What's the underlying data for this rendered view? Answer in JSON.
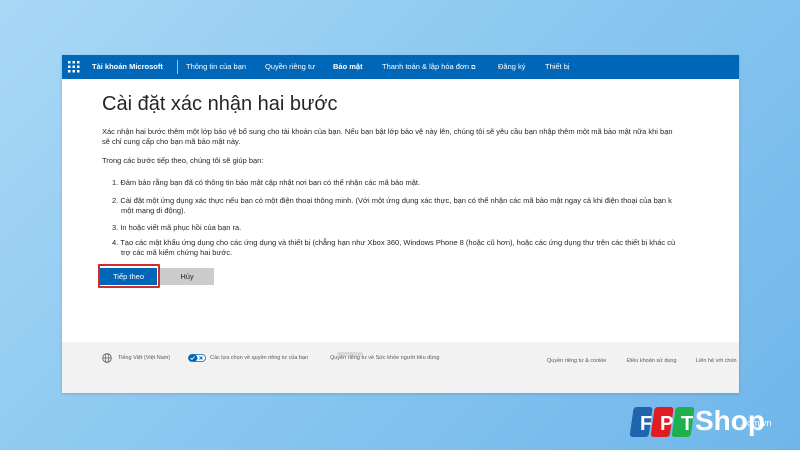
{
  "topbar": {
    "brand": "Tài khoản Microsoft",
    "nav": [
      {
        "label": "Thông tin của bạn"
      },
      {
        "label": "Quyền riêng tư"
      },
      {
        "label": "Bảo mật"
      },
      {
        "label": "Thanh toán & lập hóa đơn"
      },
      {
        "label": "Đăng ký"
      },
      {
        "label": "Thiết bị"
      }
    ],
    "active": "Bảo mật",
    "color": "#0067b8"
  },
  "page": {
    "title": "Cài đặt xác nhận hai bước",
    "intro_line1": "Xác nhận hai bước thêm một lớp bảo vệ bổ sung cho tài khoản của bạn. Nếu bạn bật lớp bảo vệ này lên, chúng tôi sẽ yêu cầu bạn nhập thêm một mã bảo mật nữa khi bạn",
    "intro_line2": "sẽ chỉ cung cấp cho bạn mã bảo mật này.",
    "lead": "Trong các bước tiếp theo, chúng tôi sẽ giúp bạn:",
    "steps": [
      {
        "line1": "1. Đảm bảo rằng bạn đã có thông tin bảo mật cập nhật nơi bạn có thể nhận các mã bảo mật.",
        "line2": ""
      },
      {
        "line1": "2. Cài đặt một ứng dụng xác thực nếu bạn có một điện thoại thông minh. (Với một ứng dụng xác thực, bạn có thể nhận các mã bảo mật ngay cả khi điện thoại của bạn k",
        "line2": "một mạng di động)."
      },
      {
        "line1": "3. In hoặc viết mã phục hồi của bạn ra.",
        "line2": ""
      },
      {
        "line1": "4. Tạo các mật khẩu ứng dụng cho các ứng dụng và thiết bị (chẳng hạn như Xbox 360, Windows Phone 8 (hoặc cũ hơn), hoặc các ứng dụng thư trên các thiết bị khác cù",
        "line2": "trợ các mã kiểm chứng hai bước."
      }
    ],
    "next_button": "Tiếp theo",
    "cancel_button": "Hủy",
    "highlight_color": "#d12b2b"
  },
  "footer": {
    "language": "Tiếng Việt (Việt Nam)",
    "privacy_choices": "Các lựa chọn về quyền riêng tư của bạn",
    "health_privacy": "Quyền riêng tư về Sức khỏe người tiêu dùng",
    "privacy_cookie": "Quyền riêng tư & cookie",
    "terms": "Điều khoản sử dụng",
    "contact": "Liên hệ với chún"
  },
  "logo": {
    "letters": [
      "F",
      "P",
      "T"
    ],
    "shop": "Shop",
    "domain": ".com.vn",
    "colors": [
      "#1f64ad",
      "#e21b23",
      "#1fb04b"
    ]
  }
}
